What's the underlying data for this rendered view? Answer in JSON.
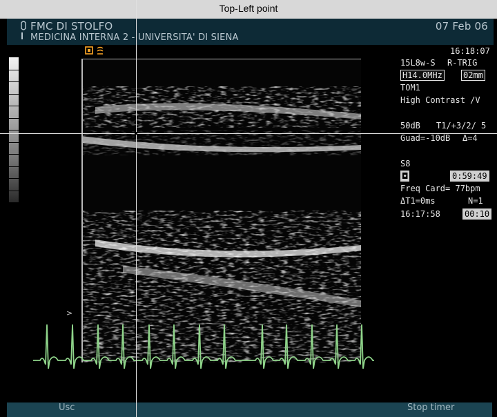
{
  "overlay": {
    "label": "Top-Left point"
  },
  "header": {
    "hospital": "FMC DI STOLFO",
    "department": "MEDICINA INTERNA 2 - UNIVERSITA' DI SIENA",
    "date": "07 Feb 06"
  },
  "info_panel": {
    "time": "16:18:07",
    "probe": "15L8w-S",
    "trigger": "R-TRIG",
    "frequency": "H14.0MHz",
    "depth": "02mm",
    "mode": "TOM1",
    "contrast": "High Contrast /V",
    "gain": "50dB",
    "settings": "T1/+3/2/ 5",
    "guad": "Guad=-10dB",
    "delta": "Δ=4",
    "scan": "S8",
    "timer": "0:59:49",
    "heart_rate": "Freq Card= 77bpm",
    "delta_t": "ΔT1=0ms",
    "n": "N=1",
    "time2": "16:17:58",
    "counter": "00:10"
  },
  "softkeys": {
    "left": "Usc",
    "right": "Stop timer"
  },
  "colors": {
    "ecg": "#8fd48a",
    "header_band": "#0d2a36",
    "softkey_band": "#1b4452",
    "orientation": "#ffa726"
  },
  "icons": [
    "probe-icon",
    "orientation-icon",
    "cine-icon"
  ]
}
